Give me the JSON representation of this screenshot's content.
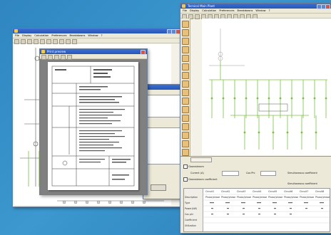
{
  "left_window": {
    "title": "",
    "menu": [
      "File",
      "Display",
      "Calculation",
      "Preferences",
      "Breakdowns",
      "Window",
      "?"
    ]
  },
  "preview_window": {
    "title": "Print preview"
  },
  "right_window": {
    "title": "Tecnical Main Plant",
    "menu": [
      "File",
      "Display",
      "Calculation",
      "Preferences",
      "Breakdowns",
      "Window",
      "?"
    ],
    "bottom_panel": {
      "check_1": "Downstream",
      "check_2": "Downstream coefficient",
      "label_current": "Current (A)",
      "label_cosphi": "Cos Phi",
      "label_coeff": "Simultaneous coefficient",
      "table_headers": [
        "Circuit1",
        "Circuit2",
        "Circuit3",
        "Circuit4",
        "Circuit5",
        "Circuit6",
        "Circuit7",
        "Circuit8"
      ],
      "row_labels": [
        "Description",
        "Type",
        "Power(kW)",
        "Cos phi",
        "Coefficient",
        "Utilization"
      ],
      "cell_value": "Phase/phase"
    }
  },
  "colors": {
    "desktop": "#2f86c0",
    "diagram_line": "#7bc043",
    "diagram_gray": "#9a9a9a"
  }
}
